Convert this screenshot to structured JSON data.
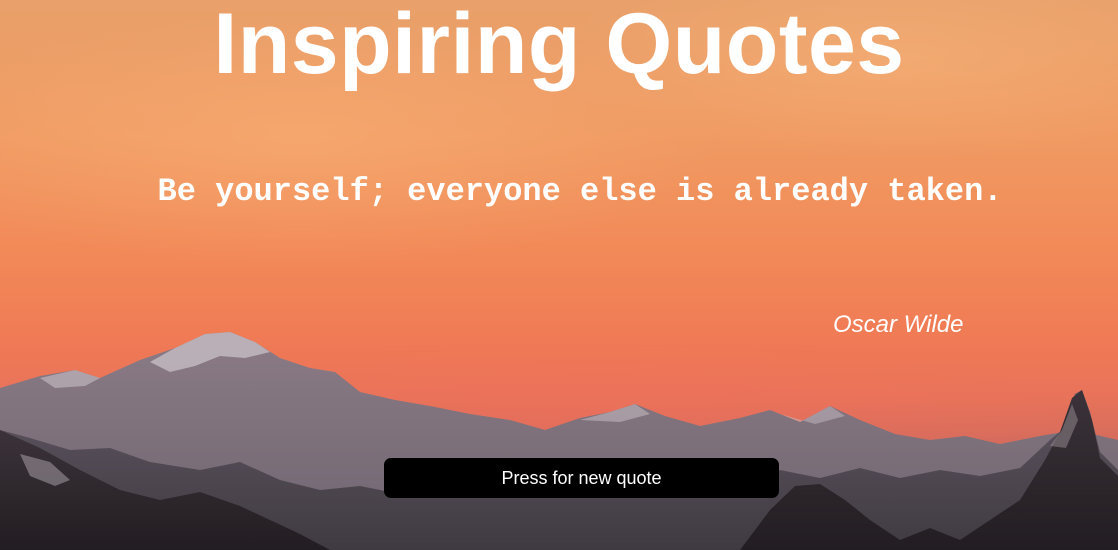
{
  "page": {
    "title": "Inspiring Quotes"
  },
  "quote": {
    "text": "Be yourself; everyone else is already taken.",
    "author": "Oscar Wilde"
  },
  "controls": {
    "new_quote_label": "Press for new quote"
  },
  "colors": {
    "text": "#ffffff",
    "button_bg": "#000000",
    "sky_top": "#e9a06a",
    "sky_bottom": "#d66c5c"
  }
}
